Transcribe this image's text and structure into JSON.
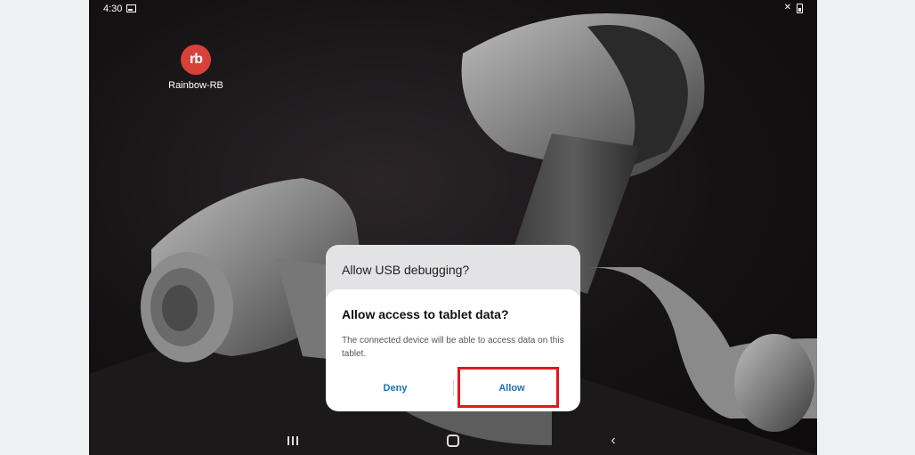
{
  "status_bar": {
    "time": "4:30"
  },
  "home": {
    "app_label": "Rainbow-RB",
    "app_logo_text": "rb"
  },
  "background_dialog": {
    "title": "Allow USB debugging?"
  },
  "dialog": {
    "title": "Allow access to tablet data?",
    "message": "The connected device will be able to access data on this tablet.",
    "deny_label": "Deny",
    "allow_label": "Allow"
  },
  "colors": {
    "accent": "#1a73b8",
    "highlight": "#e0181c",
    "logo": "#d9403a"
  },
  "nav": {
    "icons": [
      "recent-apps-icon",
      "home-icon",
      "back-icon"
    ]
  }
}
